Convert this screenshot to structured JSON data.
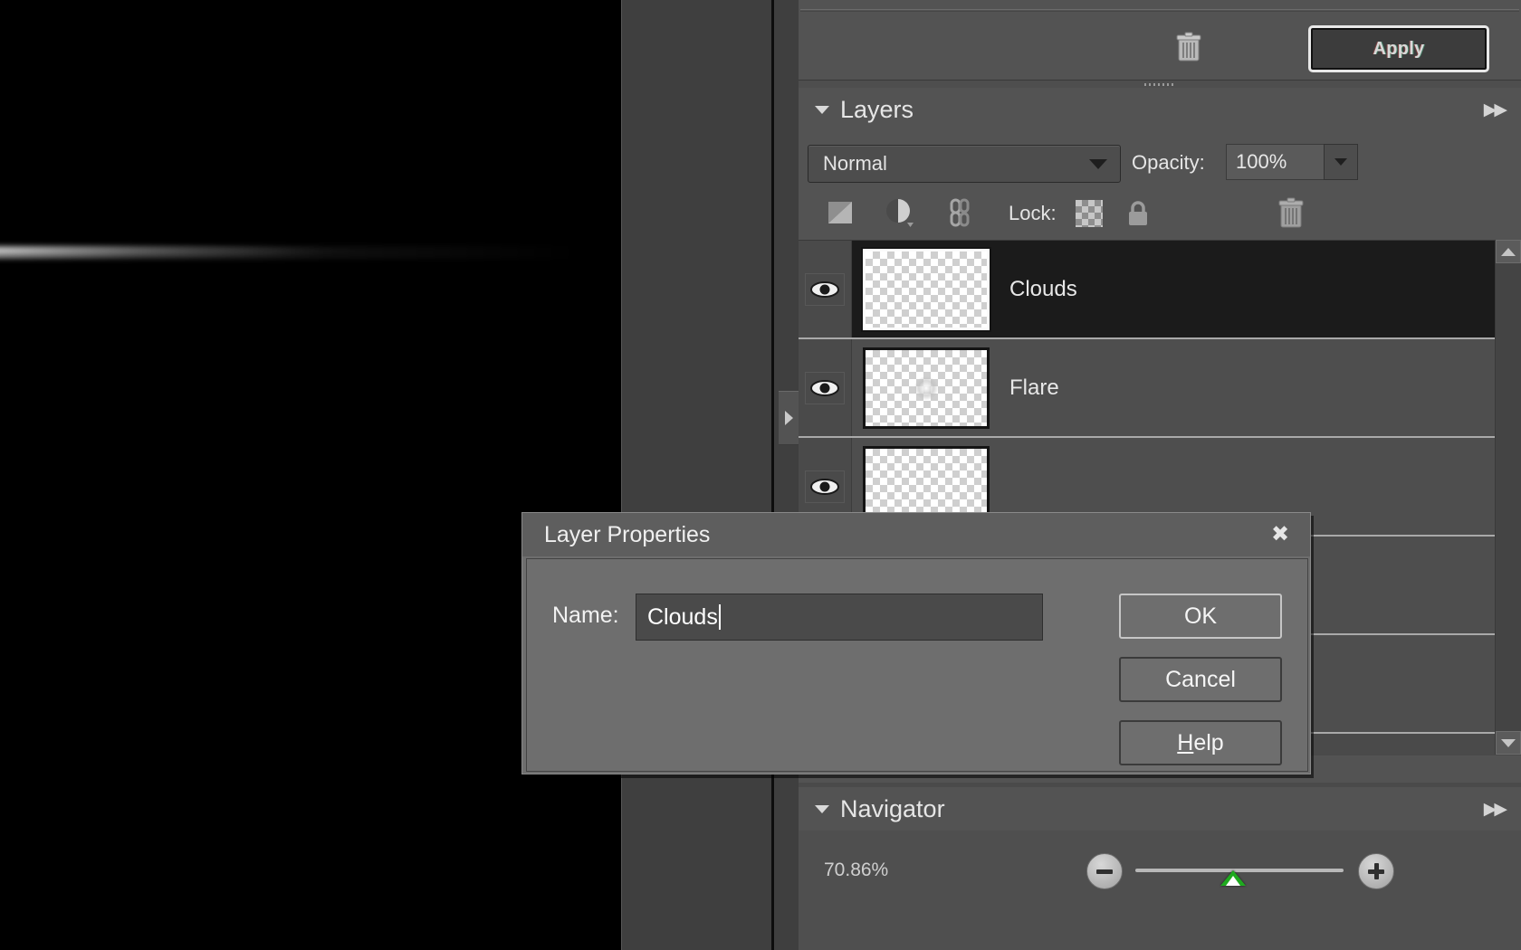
{
  "canvas": {
    "description": "black document canvas with horizontal lens-flare streak"
  },
  "adjustments_panel": {
    "delete_icon": "trash-icon",
    "apply_label": "Apply"
  },
  "layers_panel": {
    "title": "Layers",
    "menu_icon": "panel-menu-icon",
    "disclosure_icon": "triangle-down-icon",
    "blend_mode": "Normal",
    "blend_caret_icon": "caret-down-icon",
    "opacity_label": "Opacity:",
    "opacity_value": "100%",
    "opacity_caret_icon": "caret-down-icon",
    "lock_label": "Lock:",
    "tool_icons": [
      "layer-mask-icon",
      "adjustment-layer-icon",
      "link-layers-icon"
    ],
    "lock_icons": [
      "lock-transparency-checker-icon",
      "lock-all-padlock-icon"
    ],
    "delete_icon": "trash-icon",
    "rows": [
      {
        "name": "Clouds",
        "visible": true,
        "selected": true,
        "thumb": "transparent-checker"
      },
      {
        "name": "Flare",
        "visible": true,
        "selected": false,
        "thumb": "transparent-checker-with-flare"
      },
      {
        "name": "",
        "visible": true,
        "selected": false,
        "thumb": "transparent-checker"
      },
      {
        "name": "",
        "visible": true,
        "selected": false,
        "thumb": "transparent-checker"
      },
      {
        "name": "",
        "visible": true,
        "selected": false,
        "thumb": "transparent-checker"
      }
    ],
    "scroll_up_icon": "scroll-up-arrow-icon",
    "scroll_down_icon": "scroll-down-arrow-icon"
  },
  "navigator_panel": {
    "title": "Navigator",
    "menu_icon": "panel-menu-icon",
    "disclosure_icon": "triangle-down-icon",
    "zoom_percent": "70.86%",
    "zoom_out_icon": "zoom-out-icon",
    "zoom_in_icon": "zoom-in-icon",
    "slider_position_pct": 41
  },
  "dialog": {
    "title": "Layer Properties",
    "close_icon": "close-icon",
    "name_label": "Name:",
    "name_value": "Clouds",
    "buttons": {
      "ok": "OK",
      "cancel": "Cancel",
      "help_accel": "H",
      "help_rest": "elp"
    }
  },
  "dock": {
    "expander_icon": "panel-expand-arrow-icon"
  },
  "colors": {
    "panel_bg": "#535353",
    "list_bg": "#4e4e4e",
    "selected_row": "#1b1b1b",
    "dialog_bg": "#6e6e6e",
    "accent_green": "#1faa1f"
  }
}
